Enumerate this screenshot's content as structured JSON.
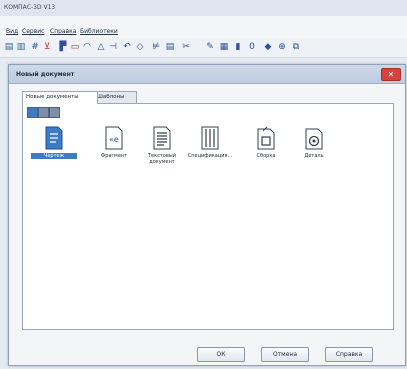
{
  "app": {
    "title": "КОМПАС-3D V13",
    "menu": [
      "Вид",
      "Сервис",
      "Справка",
      "Библиотеки"
    ]
  },
  "dialog": {
    "title": "Новый документ",
    "close_icon": "close-icon",
    "tabs": [
      "Новые документы",
      "Шаблоны"
    ],
    "view_buttons": [
      "large-icons-view",
      "small-icons-view",
      "list-view"
    ],
    "items": [
      {
        "label": "Чертеж",
        "icon": "drawing-icon"
      },
      {
        "label": "Фрагмент",
        "icon": "fragment-icon"
      },
      {
        "label": "Текстовый документ",
        "icon": "text-document-icon"
      },
      {
        "label": "Спецификация...",
        "icon": "specification-icon"
      },
      {
        "label": "Сборка",
        "icon": "assembly-icon"
      },
      {
        "label": "Деталь",
        "icon": "part-icon"
      }
    ],
    "buttons": {
      "ok": "ОК",
      "cancel": "Отмена",
      "help": "Справка"
    }
  },
  "colors": {
    "accent": "#3d7bc4",
    "close": "#d5433c"
  }
}
